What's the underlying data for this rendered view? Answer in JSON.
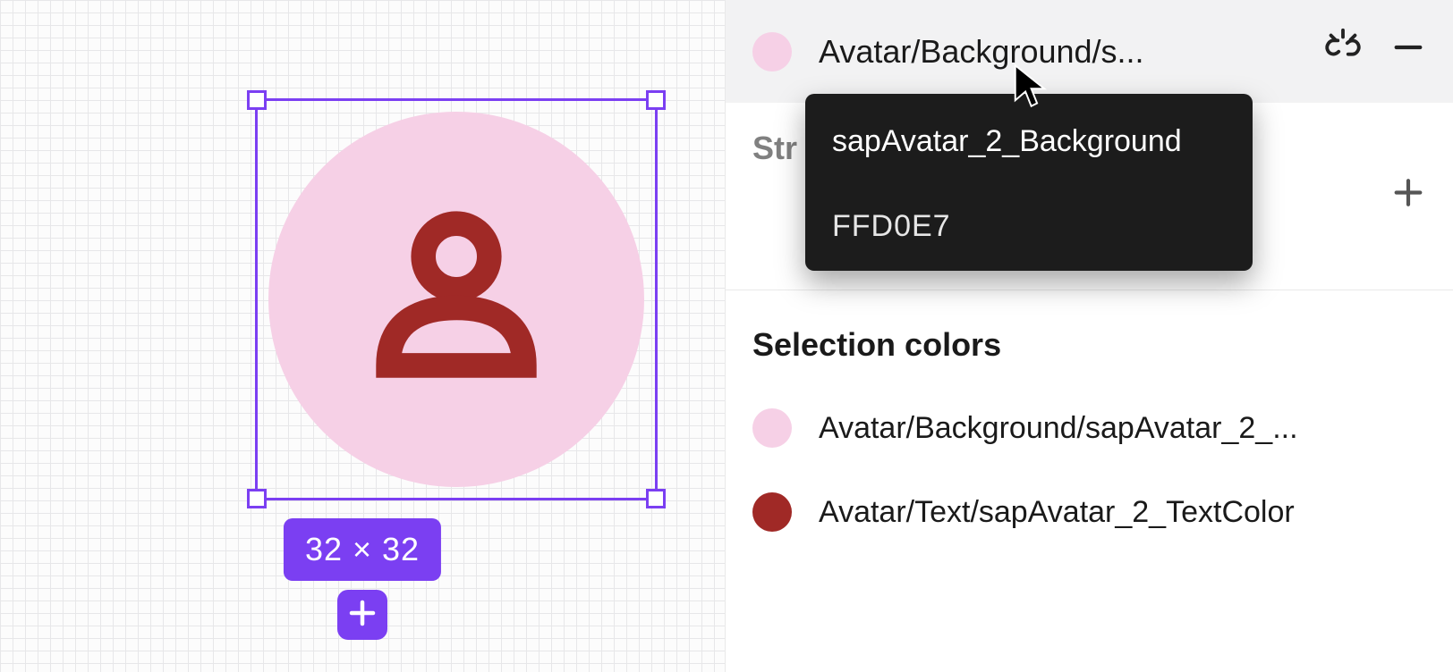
{
  "canvas": {
    "dimensions_label": "32 × 32",
    "avatar_bg_color": "#F6D0E6",
    "avatar_icon_color": "#A02926",
    "selection_color": "#7B3FF2"
  },
  "fill_row": {
    "swatch_color": "#F6D0E6",
    "label_display": "Avatar/Background/s...",
    "label_full": "Avatar/Background/sapAvatar_2_Background"
  },
  "tooltip": {
    "title": "sapAvatar_2_Background",
    "value": "FFD0E7"
  },
  "stroke_section": {
    "title_display": "Str",
    "title_full": "Stroke"
  },
  "selection_colors": {
    "title": "Selection colors",
    "items": [
      {
        "swatch_color": "#F6D0E6",
        "label_display": "Avatar/Background/sapAvatar_2_...",
        "label_full": "Avatar/Background/sapAvatar_2_Background"
      },
      {
        "swatch_color": "#A02926",
        "label_display": "Avatar/Text/sapAvatar_2_TextColor",
        "label_full": "Avatar/Text/sapAvatar_2_TextColor"
      }
    ]
  },
  "icons": {
    "detach_style": "detach-style-icon",
    "remove": "minus-icon",
    "add": "plus-icon",
    "add_fab": "plus-icon",
    "cursor": "cursor-icon",
    "person": "person-icon"
  }
}
